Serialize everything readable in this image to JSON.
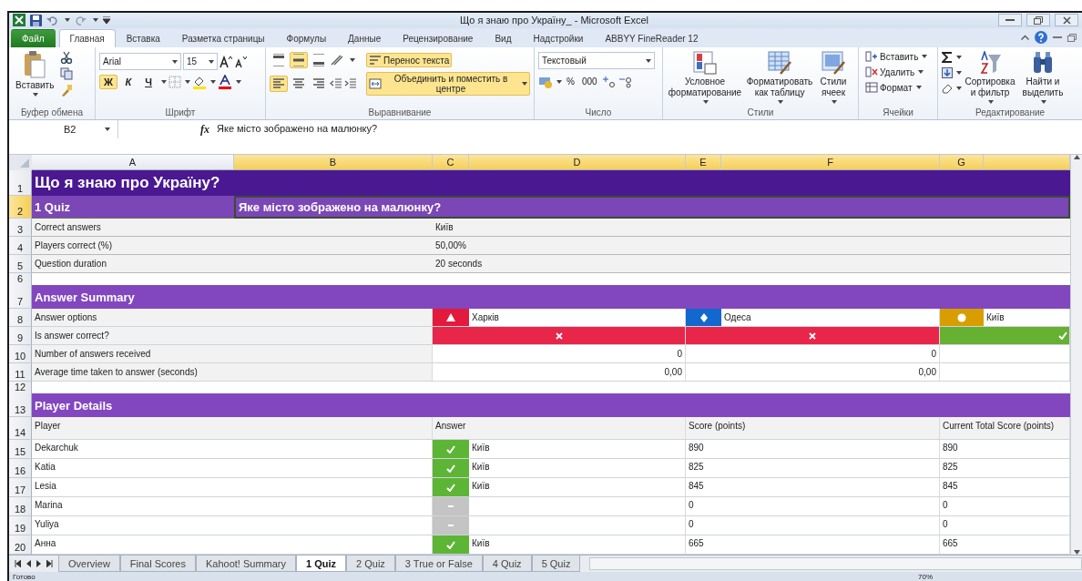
{
  "window": {
    "title": "Що я знаю про Україну_ - Microsoft Excel"
  },
  "ribbon_tabs": [
    {
      "label": "Файл",
      "kind": "file",
      "selected": false
    },
    {
      "label": "Главная",
      "kind": "tab",
      "selected": true
    },
    {
      "label": "Вставка",
      "kind": "tab",
      "selected": false
    },
    {
      "label": "Разметка страницы",
      "kind": "tab",
      "selected": false
    },
    {
      "label": "Формулы",
      "kind": "tab",
      "selected": false
    },
    {
      "label": "Данные",
      "kind": "tab",
      "selected": false
    },
    {
      "label": "Рецензирование",
      "kind": "tab",
      "selected": false
    },
    {
      "label": "Вид",
      "kind": "tab",
      "selected": false
    },
    {
      "label": "Надстройки",
      "kind": "tab",
      "selected": false
    },
    {
      "label": "ABBYY FineReader 12",
      "kind": "tab",
      "selected": false
    }
  ],
  "ribbon": {
    "clipboard": {
      "label": "Буфер обмена",
      "paste": "Вставить"
    },
    "font": {
      "label": "Шрифт",
      "family": "Arial",
      "size": "15",
      "styles": [
        {
          "label": "Ж",
          "selected": true
        },
        {
          "label": "К",
          "selected": false
        },
        {
          "label": "Ч",
          "selected": false
        }
      ]
    },
    "alignment": {
      "label": "Выравнивание",
      "vertical": [
        {
          "selected": false
        },
        {
          "selected": true
        },
        {
          "selected": false
        }
      ],
      "horizontal": [
        {
          "selected": true
        },
        {
          "selected": false
        },
        {
          "selected": false
        }
      ],
      "wrap": {
        "label": "Перенос текста",
        "selected": true
      },
      "merge": {
        "label": "Объединить и поместить в центре",
        "selected": true
      }
    },
    "number": {
      "label": "Число",
      "format": "Текстовый",
      "percent": "%",
      "thousands": "000"
    },
    "styles": {
      "label": "Стили",
      "buttons": [
        "Условное форматирование",
        "Форматировать как таблицу",
        "Стили ячеек"
      ]
    },
    "cells": {
      "label": "Ячейки",
      "buttons": [
        "Вставить",
        "Удалить",
        "Формат"
      ]
    },
    "editing": {
      "label": "Редактирование",
      "buttons": [
        "Сортировка и фильтр",
        "Найти и выделить"
      ]
    }
  },
  "formula_bar": {
    "cell": "B2",
    "function_label": "fx",
    "value": "Яке місто зображено на малюнку?"
  },
  "sheet": {
    "columns": [
      {
        "letter": "A",
        "selected": false
      },
      {
        "letter": "B",
        "selected": true
      },
      {
        "letter": "C",
        "selected": true
      },
      {
        "letter": "D",
        "selected": true
      },
      {
        "letter": "E",
        "selected": true
      },
      {
        "letter": "F",
        "selected": true
      },
      {
        "letter": "G",
        "selected": true
      },
      {
        "selected": true
      }
    ],
    "row_headers": [
      {
        "number": "1",
        "selected": false
      },
      {
        "number": "2",
        "selected": true
      },
      {
        "number": "3",
        "selected": false
      },
      {
        "number": "4",
        "selected": false
      },
      {
        "number": "5",
        "selected": false
      },
      {
        "number": "6",
        "selected": false
      },
      {
        "number": "7",
        "selected": false
      },
      {
        "number": "8",
        "selected": false
      },
      {
        "number": "9",
        "selected": false
      },
      {
        "number": "10",
        "selected": false
      },
      {
        "number": "11",
        "selected": false
      },
      {
        "number": "12",
        "selected": false
      },
      {
        "number": "13",
        "selected": false
      },
      {
        "number": "14",
        "selected": false
      },
      {
        "number": "15",
        "selected": false
      },
      {
        "number": "16",
        "selected": false
      },
      {
        "number": "17",
        "selected": false
      },
      {
        "number": "18",
        "selected": false
      },
      {
        "number": "19",
        "selected": false
      },
      {
        "number": "20",
        "selected": false
      }
    ],
    "title": "Що я знаю про Україну?",
    "quiz": [
      {
        "text": "1 Quiz",
        "selected": false
      },
      {
        "text": "Яке місто зображено на малюнку?",
        "selected": true
      }
    ],
    "info": [
      {
        "label": "Correct answers",
        "value": "Київ"
      },
      {
        "label": "Players correct (%)",
        "value": "50,00%"
      },
      {
        "label": "Question duration",
        "value": "20 seconds"
      }
    ],
    "answer_summary": {
      "title": "Answer Summary",
      "row_labels": [
        "Answer options",
        "Is answer correct?",
        "Number of answers received",
        "Average time taken to answer (seconds)"
      ],
      "options": [
        {
          "kind": "triangle",
          "color": "#e21b3c",
          "label": "Харків",
          "correct": false,
          "answers": "0",
          "average_time": "0,00"
        },
        {
          "kind": "diamond",
          "color": "#1368ce",
          "label": "Одеса",
          "correct": false,
          "answers": "0",
          "average_time": "0,00"
        },
        {
          "kind": "circle",
          "color": "#d89e00",
          "label": "Київ",
          "correct": true
        }
      ]
    },
    "player_details": {
      "title": "Player Details",
      "columns": [
        "Player",
        "Answer",
        "Score (points)",
        "Current Total Score (points)"
      ],
      "players": [
        {
          "name": "Dekarchuk",
          "answered": true,
          "answer": "Київ",
          "score": "890",
          "total": "890"
        },
        {
          "name": "Katia",
          "answered": true,
          "answer": "Київ",
          "score": "825",
          "total": "825"
        },
        {
          "name": "Lesia",
          "answered": true,
          "answer": "Київ",
          "score": "845",
          "total": "845"
        },
        {
          "name": "Marina",
          "answered": false,
          "score": "0",
          "total": "0"
        },
        {
          "name": "Yuliya",
          "answered": false,
          "score": "0",
          "total": "0"
        },
        {
          "name": "Анна",
          "answered": true,
          "answer": "Київ",
          "score": "665",
          "total": "665"
        }
      ]
    }
  },
  "sheet_tabs": [
    {
      "label": "Overview",
      "selected": false
    },
    {
      "label": "Final Scores",
      "selected": false
    },
    {
      "label": "Kahoot! Summary",
      "selected": false
    },
    {
      "label": "1 Quiz",
      "selected": true
    },
    {
      "label": "2 Quiz",
      "selected": false
    },
    {
      "label": "3 True or False",
      "selected": false
    },
    {
      "label": "4 Quiz",
      "selected": false
    },
    {
      "label": "5 Quiz",
      "selected": false
    }
  ],
  "status_bar": {
    "text": "Готово",
    "zoom": "70%"
  }
}
